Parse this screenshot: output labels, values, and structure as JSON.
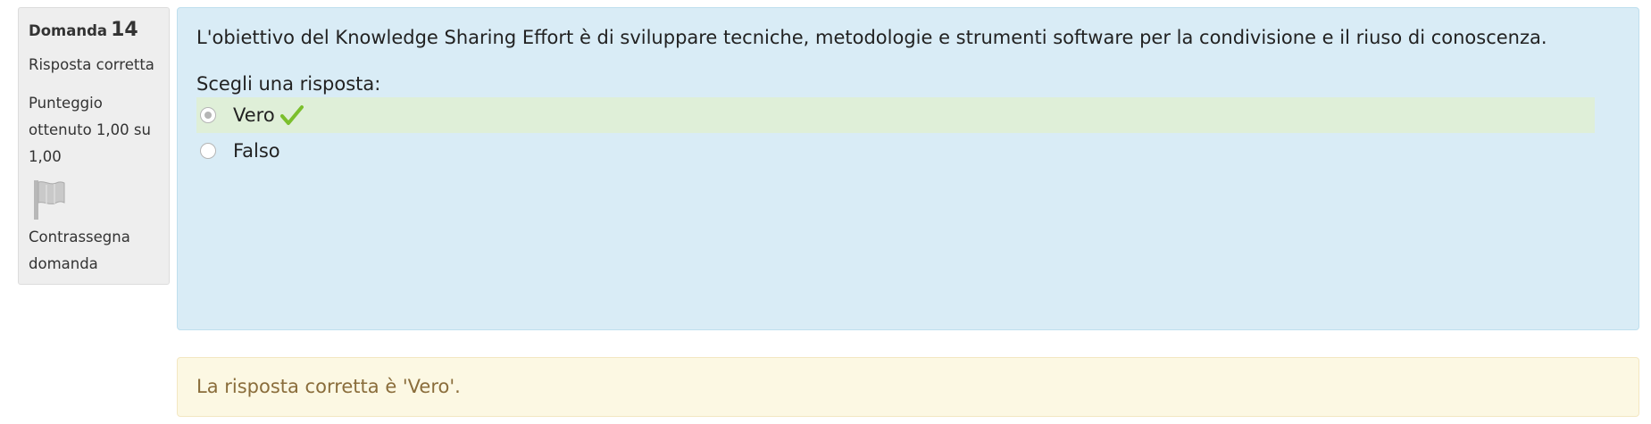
{
  "info": {
    "question_label": "Domanda",
    "question_number": "14",
    "state": "Risposta corretta",
    "grade_line1": "Punteggio",
    "grade_line2": "ottenuto 1,00 su",
    "grade_line3": "1,00",
    "flag_line1": "Contrassegna",
    "flag_line2": "domanda"
  },
  "question": {
    "text": "L'obiettivo del Knowledge Sharing Effort è di sviluppare tecniche, metodologie e strumenti software per la condivisione e il riuso di conoscenza.",
    "prompt": "Scegli una risposta:",
    "options": [
      {
        "label": "Vero",
        "selected": true,
        "correct": true
      },
      {
        "label": "Falso",
        "selected": false,
        "correct": false
      }
    ]
  },
  "feedback": {
    "right_answer": "La risposta corretta è 'Vero'."
  },
  "colors": {
    "formulation_bg": "#d9ecf6",
    "correct_bg": "#dfefd8",
    "feedback_bg": "#fcf8e3",
    "feedback_text": "#8a6d3b",
    "check_color": "#7bbf2c"
  },
  "icons": {
    "flag": "flag-icon",
    "check": "check-icon"
  }
}
